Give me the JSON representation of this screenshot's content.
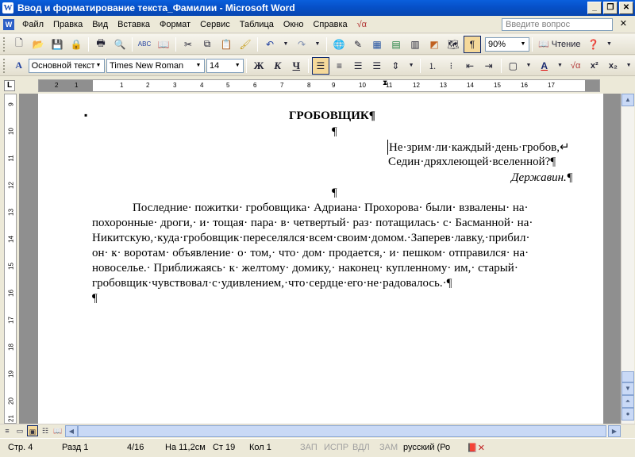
{
  "window": {
    "title": "Ввод и форматирование текста_Фамилии - Microsoft Word",
    "app_icon_text": "W"
  },
  "menu": {
    "items": [
      "Файл",
      "Правка",
      "Вид",
      "Вставка",
      "Формат",
      "Сервис",
      "Таблица",
      "Окно",
      "Справка"
    ],
    "help_placeholder": "Введите вопрос"
  },
  "standard_toolbar": {
    "zoom": "90%",
    "reading_label": "Чтение"
  },
  "formatting_toolbar": {
    "style": "Основной текст",
    "font": "Times New Roman",
    "size": "14",
    "bold": "Ж",
    "italic": "К",
    "underline": "Ч"
  },
  "ruler": {
    "h_ticks": [
      "2",
      "1",
      "1",
      "2",
      "3",
      "4",
      "5",
      "6",
      "7",
      "8",
      "9",
      "10",
      "11",
      "12",
      "13",
      "14",
      "15",
      "16",
      "17"
    ],
    "v_ticks": [
      "9",
      "10",
      "11",
      "12",
      "13",
      "14",
      "15",
      "16",
      "17",
      "18",
      "19",
      "20",
      "21"
    ]
  },
  "document": {
    "title": "ГРОБОВЩИК¶",
    "empty_para": "¶",
    "epigraph_line1": "Не·зрим·ли·каждый·день·гробов,↵",
    "epigraph_line2": "Седин·дряхлеющей·вселенной?¶",
    "epigraph_author": "Державин.¶",
    "body_lines": [
      "Последние· пожитки· гробовщика· Адриана· Прохорова· были· взвалены· на·",
      "похоронные· дроги,· и· тощая· пара· в· четвертый· раз· потащилась· с· Басманной· на·",
      "Никитскую,·куда·гробовщик·переселялся·всем·своим·домом.·Заперев·лавку,·прибил·",
      "он· к· воротам· объявление· о· том,· что· дом· продается,· и· пешком· отправился· на·",
      "новоселье.· Приближаясь· к· желтому· домику,· наконец· купленному· им,· старый·",
      "гробовщик·чувствовал·с·удивлением,·что·сердце·его·не·радовалось.·¶"
    ],
    "last_para": "¶"
  },
  "status": {
    "page": "Стр. 4",
    "section": "Разд 1",
    "pages": "4/16",
    "at": "На 11,2см",
    "line": "Ст 19",
    "col": "Кол 1",
    "rec": "ЗАП",
    "trk": "ИСПР",
    "ext": "ВДЛ",
    "ovr": "ЗАМ",
    "lang": "русский (Ро"
  }
}
